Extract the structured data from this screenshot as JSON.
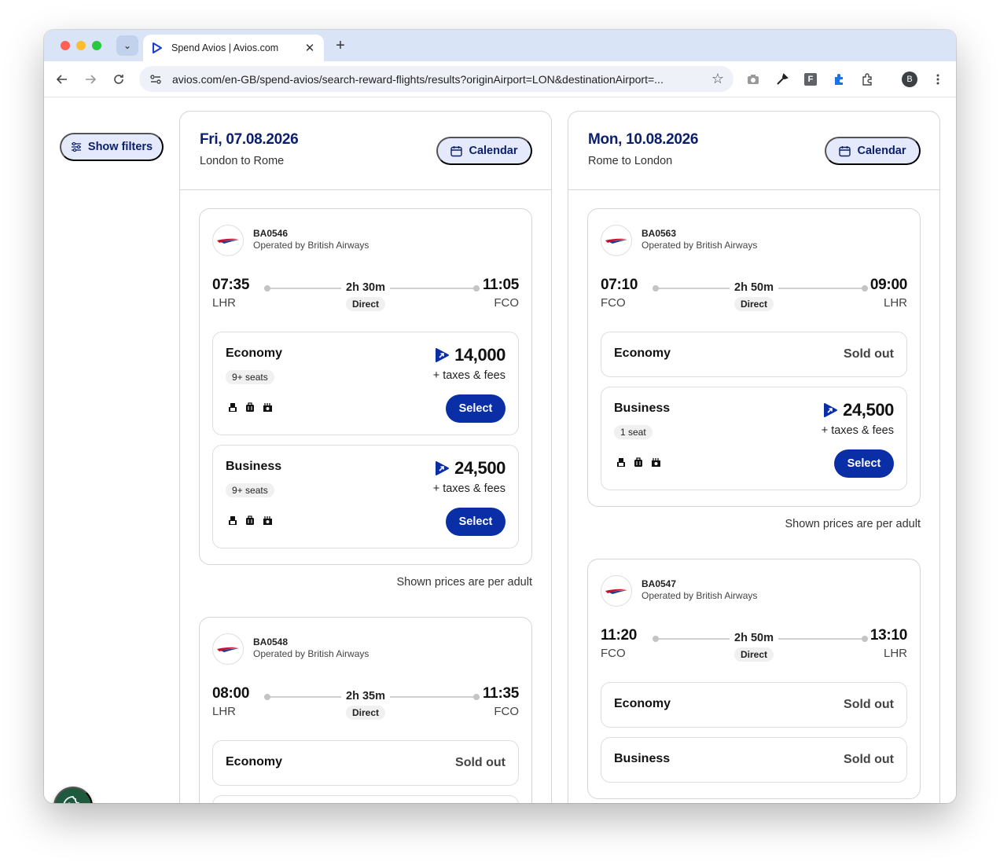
{
  "browser": {
    "tab_title": "Spend Avios | Avios.com",
    "url": "avios.com/en-GB/spend-avios/search-reward-flights/results?originAirport=LON&destinationAirport=...",
    "profile_initial": "B",
    "ext_f_label": "F"
  },
  "sidebar": {
    "filters_label": "Show filters"
  },
  "outbound": {
    "date": "Fri, 07.08.2026",
    "route": "London to Rome",
    "calendar_label": "Calendar",
    "per_adult_note": "Shown prices are per adult",
    "flights": [
      {
        "flight_no": "BA0546",
        "operator": "Operated by British Airways",
        "dep_time": "07:35",
        "dep_code": "LHR",
        "arr_time": "11:05",
        "arr_code": "FCO",
        "duration": "2h 30m",
        "stops": "Direct",
        "cabins": [
          {
            "name": "Economy",
            "seats": "9+ seats",
            "price": "14,000",
            "taxes": "+ taxes & fees",
            "action": "Select"
          },
          {
            "name": "Business",
            "seats": "9+ seats",
            "price": "24,500",
            "taxes": "+ taxes & fees",
            "action": "Select"
          }
        ]
      },
      {
        "flight_no": "BA0548",
        "operator": "Operated by British Airways",
        "dep_time": "08:00",
        "dep_code": "LHR",
        "arr_time": "11:35",
        "arr_code": "FCO",
        "duration": "2h 35m",
        "stops": "Direct",
        "cabins": [
          {
            "name": "Economy",
            "status": "Sold out"
          }
        ]
      }
    ]
  },
  "inbound": {
    "date": "Mon, 10.08.2026",
    "route": "Rome to London",
    "calendar_label": "Calendar",
    "per_adult_note": "Shown prices are per adult",
    "flights": [
      {
        "flight_no": "BA0563",
        "operator": "Operated by British Airways",
        "dep_time": "07:10",
        "dep_code": "FCO",
        "arr_time": "09:00",
        "arr_code": "LHR",
        "duration": "2h 50m",
        "stops": "Direct",
        "cabins": [
          {
            "name": "Economy",
            "status": "Sold out"
          },
          {
            "name": "Business",
            "seats": "1 seat",
            "price": "24,500",
            "taxes": "+ taxes & fees",
            "action": "Select"
          }
        ]
      },
      {
        "flight_no": "BA0547",
        "operator": "Operated by British Airways",
        "dep_time": "11:20",
        "dep_code": "FCO",
        "arr_time": "13:10",
        "arr_code": "LHR",
        "duration": "2h 50m",
        "stops": "Direct",
        "cabins": [
          {
            "name": "Economy",
            "status": "Sold out"
          },
          {
            "name": "Business",
            "status": "Sold out"
          }
        ]
      }
    ]
  },
  "colors": {
    "brand_navy": "#0b1f6b",
    "select_blue": "#0a2ea6",
    "pill_bg": "#e4e9fb",
    "cookie_green": "#1e5a3e"
  },
  "icons": [
    "search-tabs-icon",
    "avios-favicon",
    "back-arrow-icon",
    "forward-arrow-icon",
    "reload-icon",
    "site-settings-icon",
    "bookmark-star-icon",
    "camera-icon",
    "eyedropper-icon",
    "extension-puzzle-icon",
    "sidepanel-icon",
    "more-menu-icon",
    "filter-sliders-icon",
    "calendar-icon",
    "ba-speedmarque-logo",
    "avios-points-icon",
    "seat-icon",
    "baggage-icon",
    "meal-icon",
    "cookie-icon"
  ]
}
